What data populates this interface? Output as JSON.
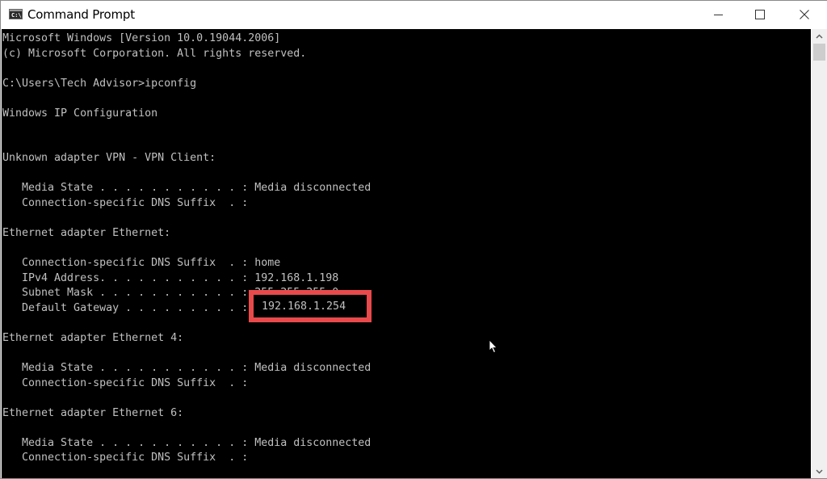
{
  "window": {
    "title": "Command Prompt",
    "app_icon_text": "C:\\.",
    "controls": {
      "minimize": "minimize-icon",
      "maximize": "maximize-icon",
      "close": "close-icon"
    }
  },
  "console": {
    "lines": [
      "Microsoft Windows [Version 10.0.19044.2006]",
      "(c) Microsoft Corporation. All rights reserved.",
      "",
      "C:\\Users\\Tech Advisor>ipconfig",
      "",
      "Windows IP Configuration",
      "",
      "",
      "Unknown adapter VPN - VPN Client:",
      "",
      "   Media State . . . . . . . . . . . : Media disconnected",
      "   Connection-specific DNS Suffix  . :",
      "",
      "Ethernet adapter Ethernet:",
      "",
      "   Connection-specific DNS Suffix  . : home",
      "   IPv4 Address. . . . . . . . . . . : 192.168.1.198",
      "   Subnet Mask . . . . . . . . . . . : 255.255.255.0",
      "   Default Gateway . . . . . . . . . : 192.168.1.254",
      "",
      "Ethernet adapter Ethernet 4:",
      "",
      "   Media State . . . . . . . . . . . : Media disconnected",
      "   Connection-specific DNS Suffix  . :",
      "",
      "Ethernet adapter Ethernet 6:",
      "",
      "   Media State . . . . . . . . . . . : Media disconnected",
      "   Connection-specific DNS Suffix  . :"
    ],
    "highlight": {
      "label": "Default Gateway",
      "value": "192.168.1.254",
      "color": "#e84a4c"
    },
    "text_color": "#c0c0c0",
    "background": "#000000"
  },
  "scrollbar": {
    "up_icon": "chevron-up-icon",
    "down_icon": "chevron-down-icon"
  }
}
